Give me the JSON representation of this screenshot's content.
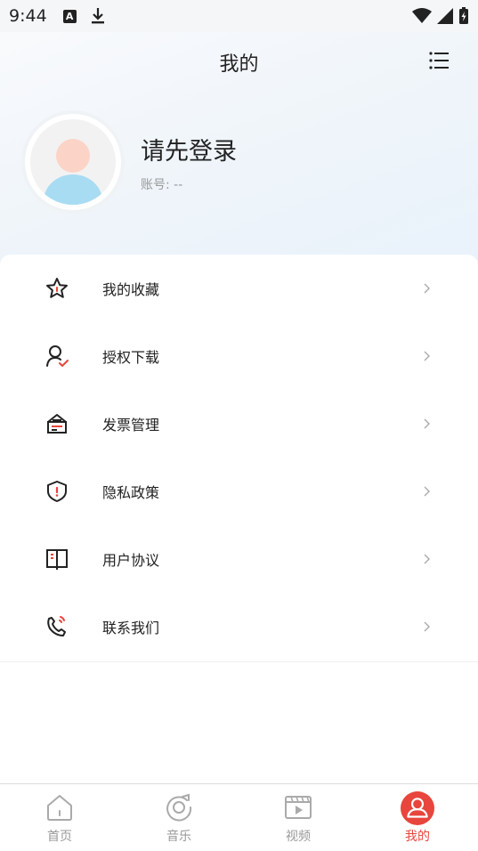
{
  "status_bar": {
    "time": "9:44",
    "notification_letter": "A"
  },
  "header": {
    "title": "我的"
  },
  "profile": {
    "login_prompt": "请先登录",
    "account": "账号: --"
  },
  "menu": [
    {
      "label": "我的收藏",
      "icon": "star-icon"
    },
    {
      "label": "授权下载",
      "icon": "user-check-icon"
    },
    {
      "label": "发票管理",
      "icon": "invoice-icon"
    },
    {
      "label": "隐私政策",
      "icon": "shield-icon"
    },
    {
      "label": "用户协议",
      "icon": "book-icon"
    },
    {
      "label": "联系我们",
      "icon": "phone-icon"
    }
  ],
  "tabs": [
    {
      "label": "首页",
      "icon": "home-icon"
    },
    {
      "label": "音乐",
      "icon": "music-disc-icon"
    },
    {
      "label": "视频",
      "icon": "video-icon"
    },
    {
      "label": "我的",
      "icon": "profile-icon",
      "active": true
    }
  ],
  "colors": {
    "accent": "#e8453c",
    "text": "#222222",
    "muted": "#999999"
  }
}
